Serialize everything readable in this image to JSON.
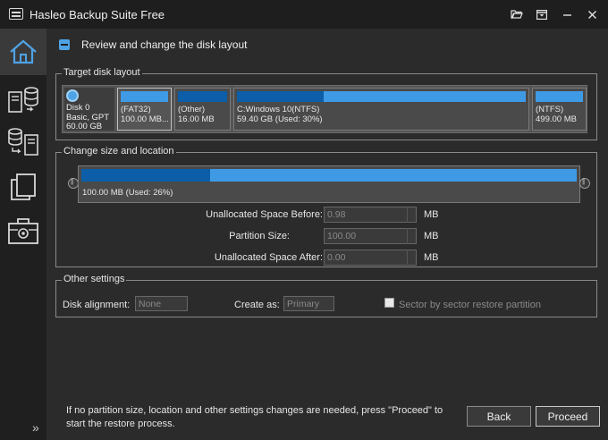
{
  "window": {
    "title": "Hasleo Backup Suite Free",
    "controls": [
      "folder-open-icon",
      "menu-icon",
      "minimize-icon",
      "close-icon"
    ]
  },
  "sidebar": {
    "items": [
      {
        "name": "home",
        "icon": "home-icon",
        "active": true
      },
      {
        "name": "backup",
        "icon": "backup-icon"
      },
      {
        "name": "restore",
        "icon": "restore-icon"
      },
      {
        "name": "clone",
        "icon": "clone-icon"
      },
      {
        "name": "tools",
        "icon": "toolbox-icon"
      }
    ],
    "expand_glyph": "»"
  },
  "page": {
    "title": "Review and change the disk layout"
  },
  "target_disk": {
    "legend": "Target disk layout",
    "disk": {
      "line1": "Disk 0",
      "line2": "Basic, GPT",
      "line3": "60.00 GB"
    },
    "partitions": [
      {
        "name": "(FAT32)",
        "size": "100.00 MB...",
        "used_fraction": 0.0,
        "selected": true
      },
      {
        "name": "(Other)",
        "size": "16.00 MB",
        "used_fraction": 1.0,
        "selected": false
      },
      {
        "name": "C:Windows 10(NTFS)",
        "size": "59.40 GB (Used: 30%)",
        "used_fraction": 0.3,
        "selected": false
      },
      {
        "name": "(NTFS)",
        "size": "499.00 MB",
        "used_fraction": 0.0,
        "selected": false
      }
    ]
  },
  "change_size": {
    "legend": "Change size and location",
    "bar_label": "100.00 MB (Used: 26%)",
    "used_fraction": 0.26,
    "fields": [
      {
        "label": "Unallocated Space Before:",
        "value": "0.98",
        "unit": "MB"
      },
      {
        "label": "Partition Size:",
        "value": "100.00",
        "unit": "MB"
      },
      {
        "label": "Unallocated Space After:",
        "value": "0.00",
        "unit": "MB"
      }
    ]
  },
  "other_settings": {
    "legend": "Other settings",
    "alignment_label": "Disk alignment:",
    "alignment_value": "None",
    "create_as_label": "Create as:",
    "create_as_value": "Primary",
    "sector_label": "Sector by sector restore partition",
    "sector_checked": false
  },
  "footer": {
    "message": "If no partition size, location and other settings changes are needed, press \"Proceed\" to start the restore process.",
    "back_label": "Back",
    "proceed_label": "Proceed"
  },
  "colors": {
    "accent": "#3f9ae6",
    "used": "#0c5ea8",
    "background": "#2b2b2b"
  }
}
